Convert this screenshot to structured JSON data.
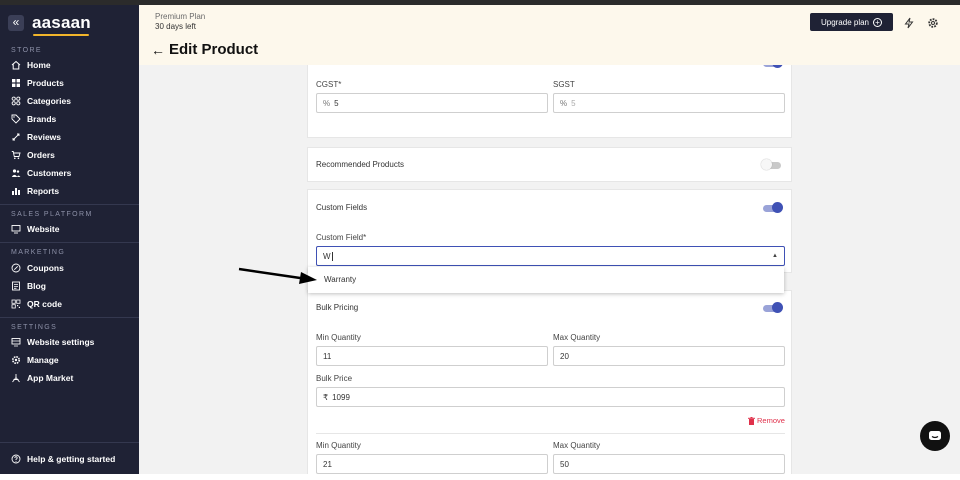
{
  "app": {
    "logo": "aasaan",
    "collapse_glyph": "«"
  },
  "sidebar": {
    "sections": [
      {
        "label": "STORE",
        "items": [
          {
            "label": "Home",
            "icon": "home-icon"
          },
          {
            "label": "Products",
            "icon": "grid-icon"
          },
          {
            "label": "Categories",
            "icon": "categories-icon"
          },
          {
            "label": "Brands",
            "icon": "tag-icon"
          },
          {
            "label": "Reviews",
            "icon": "reviews-icon"
          },
          {
            "label": "Orders",
            "icon": "cart-icon"
          },
          {
            "label": "Customers",
            "icon": "users-icon"
          },
          {
            "label": "Reports",
            "icon": "bar-chart-icon"
          }
        ]
      },
      {
        "label": "SALES PLATFORM",
        "items": [
          {
            "label": "Website",
            "icon": "monitor-icon"
          }
        ]
      },
      {
        "label": "MARKETING",
        "items": [
          {
            "label": "Coupons",
            "icon": "coupon-icon"
          },
          {
            "label": "Blog",
            "icon": "blog-icon"
          },
          {
            "label": "QR code",
            "icon": "qr-icon"
          }
        ]
      },
      {
        "label": "SETTINGS",
        "items": [
          {
            "label": "Website settings",
            "icon": "website-settings-icon"
          },
          {
            "label": "Manage",
            "icon": "gear-icon"
          },
          {
            "label": "App Market",
            "icon": "app-market-icon"
          }
        ]
      }
    ],
    "help": {
      "label": "Help & getting started",
      "icon": "help-icon"
    }
  },
  "header": {
    "plan_name": "Premium Plan",
    "plan_days": "30 days left",
    "title": "Edit Product",
    "upgrade_label": "Upgrade plan"
  },
  "tax": {
    "cgst_label": "CGST*",
    "cgst_prefix": "%",
    "cgst_value": "5",
    "sgst_label": "SGST",
    "sgst_prefix": "%",
    "sgst_placeholder": "5"
  },
  "recommended": {
    "title": "Recommended Products",
    "enabled": false
  },
  "custom_fields": {
    "title": "Custom Fields",
    "enabled": true,
    "field_label": "Custom Field*",
    "value": "W",
    "suggestion": "Warranty"
  },
  "bulk_pricing": {
    "title": "Bulk Pricing",
    "enabled": true,
    "tiers": [
      {
        "min_label": "Min Quantity",
        "min": "11",
        "max_label": "Max Quantity",
        "max": "20",
        "price_label": "Bulk Price",
        "currency": "₹",
        "price": "1099",
        "remove_label": "Remove"
      },
      {
        "min_label": "Min Quantity",
        "min": "21",
        "max_label": "Max Quantity",
        "max": "50"
      }
    ]
  },
  "colors": {
    "sidebar": "#1f2235",
    "accent": "#3f51b5",
    "header_bg": "#fdf8ec",
    "danger": "#e0314b"
  }
}
